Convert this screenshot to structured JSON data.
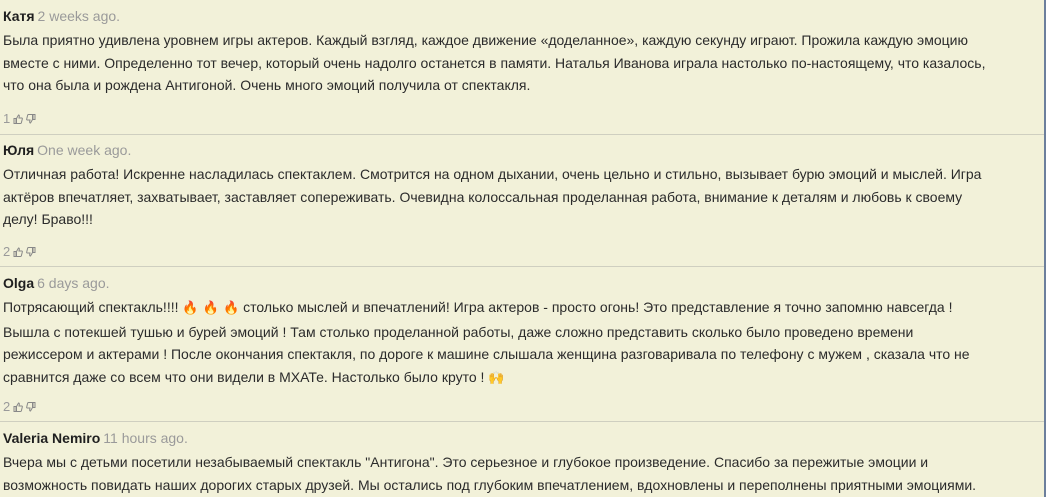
{
  "comments": [
    {
      "author": "Катя",
      "time": "2 weeks ago.",
      "lines": [
        "Была приятно  удивлена уровнем игры актеров. Каждый взгляд, каждое движение «доделанное», каждую секунду играют. Прожила каждую эмоцию",
        "вместе с ними. Определенно тот вечер, который очень надолго останется в памяти. Наталья Иванова играла настолько по-настоящему, что казалось,",
        "что она была и рождена Антигоной. Очень много эмоций получила от спектакля."
      ],
      "likes": "1"
    },
    {
      "author": "Юля",
      "time": "One week ago.",
      "lines": [
        "Отличная работа! Искренне насладилась спектаклем. Смотрится на одном дыхании, очень цельно и стильно, вызывает бурю эмоций и мыслей. Игра",
        "актёров впечатляет, захватывает, заставляет сопереживать. Очевидна колоссальная проделанная работа, внимание к деталям и любовь к своему",
        "делу! Браво!!!"
      ],
      "likes": "2"
    },
    {
      "author": "Olga",
      "time": "6 days ago.",
      "line1_before": "Потрясающий спектакль!!!! ",
      "fire_emoji": "🔥 🔥 🔥",
      "line1_after": " столько мыслей и впечатлений! Игра актеров - просто огонь! Это представление я точно запомню навсегда !",
      "lines": [
        "Вышла с потекшей тушью и бурей эмоций !  Там столько проделанной работы, даже сложно представить сколько было проведено времени",
        "режиссером и актерами ! После окончания спектакля, по дороге к машине слышала женщина разговаривала по телефону с мужем , сказала что не"
      ],
      "last_line": "сравнится даже со всем что они видели в МХАТе. Настолько было круто ! ",
      "hands_emoji": "🙌",
      "likes": "2"
    },
    {
      "author": "Valeria Nemiro",
      "time": "11 hours ago.",
      "lines": [
        "Вчера мы с детьми посетили незабываемый спектакль \"Антигона\". Это серьезное и глубокое произведение. Спасибо за пережитые эмоции и",
        "возможность повидать наших дорогих старых друзей. Мы остались под глубоким впечатлением, вдохновлены и переполнены приятными эмоциями."
      ]
    }
  ],
  "icons": {
    "like": "thumbs-up-icon",
    "dislike": "thumbs-down-icon"
  },
  "colors": {
    "background": "#f2f1d9",
    "meta": "#9a9a9a",
    "text": "#2b2b2b",
    "separator": "#cfcfc0"
  }
}
